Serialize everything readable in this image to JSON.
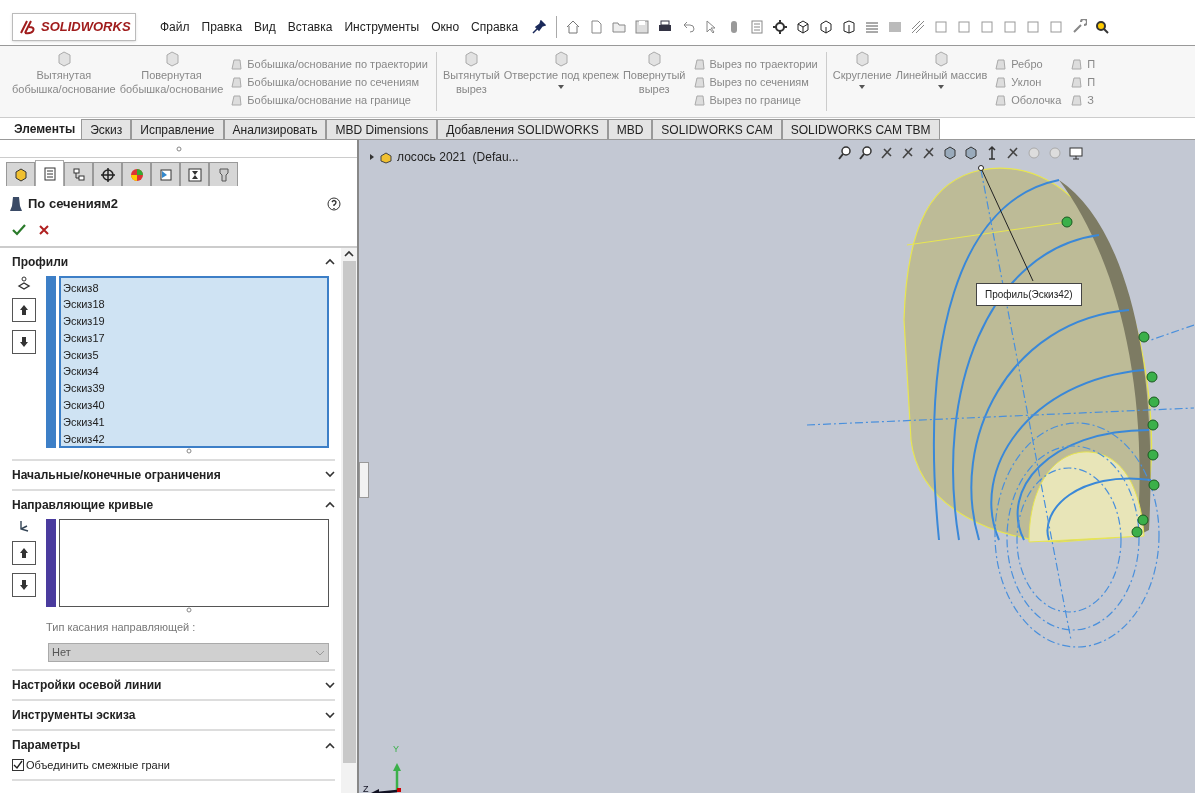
{
  "app": {
    "logo": "SOLIDWORKS"
  },
  "menu": [
    "Файл",
    "Правка",
    "Вид",
    "Вставка",
    "Инструменты",
    "Окно",
    "Справка"
  ],
  "ribbon": [
    {
      "kind": "large",
      "lines": [
        "Вытянутая",
        "бобышка/основание"
      ]
    },
    {
      "kind": "large",
      "lines": [
        "Повернутая",
        "бобышка/основание"
      ]
    },
    {
      "kind": "stack",
      "labels": [
        "Бобышка/основание по траектории",
        "Бобышка/основание по сечениям",
        "Бобышка/основание на границе"
      ]
    },
    {
      "kind": "separator"
    },
    {
      "kind": "large",
      "lines": [
        "Вытянутый",
        "вырез"
      ]
    },
    {
      "kind": "large",
      "lines": [
        "Отверстие под крепеж"
      ],
      "dropdown": true
    },
    {
      "kind": "large",
      "lines": [
        "Повернутый",
        "вырез"
      ]
    },
    {
      "kind": "stack",
      "labels": [
        "Вырез по траектории",
        "Вырез по сечениям",
        "Вырез по границе"
      ]
    },
    {
      "kind": "separator"
    },
    {
      "kind": "large",
      "lines": [
        "Скругление"
      ],
      "dropdown": true
    },
    {
      "kind": "large",
      "lines": [
        "Линейный массив"
      ],
      "dropdown": true
    },
    {
      "kind": "stack",
      "labels": [
        "Ребро",
        "Уклон",
        "Оболочка"
      ]
    },
    {
      "kind": "stack",
      "labels": [
        "П",
        "П",
        "З"
      ]
    }
  ],
  "tabs": [
    {
      "label": "Элементы",
      "selected": true
    },
    {
      "label": "Эскиз",
      "selected": false
    },
    {
      "label": "Исправление",
      "selected": false
    },
    {
      "label": "Анализировать",
      "selected": false
    },
    {
      "label": "MBD Dimensions",
      "selected": false
    },
    {
      "label": "Добавления SOLIDWORKS",
      "selected": false
    },
    {
      "label": "MBD",
      "selected": false
    },
    {
      "label": "SOLIDWORKS CAM",
      "selected": false
    },
    {
      "label": "SOLIDWORKS CAM TBM",
      "selected": false
    }
  ],
  "panel": {
    "panel_tabs": [
      {
        "selected": false
      },
      {
        "selected": true
      },
      {
        "selected": false
      },
      {
        "selected": false
      },
      {
        "selected": false
      },
      {
        "selected": false
      },
      {
        "selected": false
      },
      {
        "selected": false
      }
    ],
    "title": "По сечениям2",
    "sections": [
      {
        "kind": "list",
        "title": "Профили",
        "expanded": true,
        "color": "#3d7fc7",
        "items": [
          "Эскиз8",
          "Эскиз18",
          "Эскиз19",
          "Эскиз17",
          "Эскиз5",
          "Эскиз4",
          "Эскиз39",
          "Эскиз40",
          "Эскиз41",
          "Эскиз42"
        ]
      },
      {
        "kind": "plain",
        "title": "Начальные/конечные ограничения",
        "expanded": false
      },
      {
        "kind": "list",
        "title": "Направляющие кривые",
        "expanded": true,
        "color": "#4a3b9e",
        "field_label": "Тип касания направляющей :",
        "select": {
          "value": "Нет",
          "disabled": true
        }
      },
      {
        "kind": "plain",
        "title": "Настройки осевой линии",
        "expanded": false
      },
      {
        "kind": "plain",
        "title": "Инструменты эскиза",
        "expanded": false
      },
      {
        "kind": "options",
        "title": "Параметры",
        "expanded": true,
        "options": [
          {
            "label": "Объединить смежные грани",
            "checked": true
          }
        ]
      }
    ]
  },
  "viewport": {
    "tree_label": "лосось 2021  (Defau...",
    "callout": "Профиль(Эскиз42)",
    "triad": [
      "Y",
      "Z"
    ]
  }
}
